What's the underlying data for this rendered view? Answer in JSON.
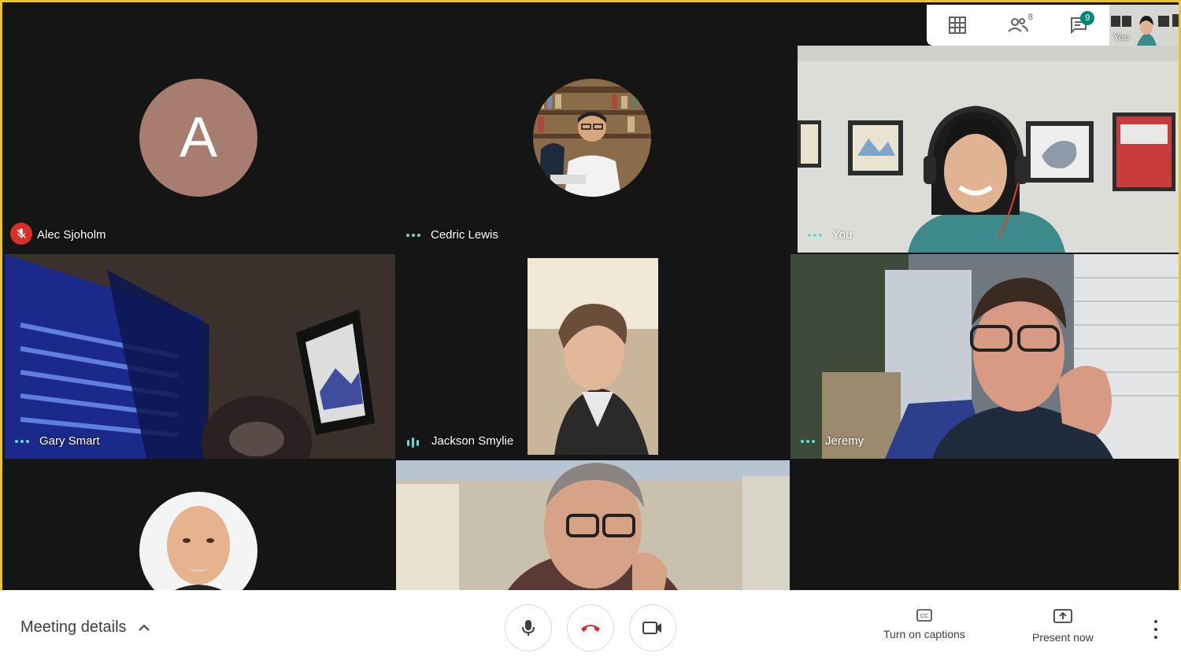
{
  "participants": {
    "alec": {
      "name": "Alec Sjoholm",
      "initial": "A",
      "muted": true
    },
    "cedric": {
      "name": "Cedric Lewis"
    },
    "you": {
      "name": "You"
    },
    "gary": {
      "name": "Gary Smart"
    },
    "jackson": {
      "name": "Jackson Smylie"
    },
    "jeremy": {
      "name": "Jeremy"
    }
  },
  "topbar": {
    "people_count": "8",
    "chat_badge": "9",
    "self_label": "You"
  },
  "bottombar": {
    "meeting_details": "Meeting details",
    "captions_label": "Turn on captions",
    "present_label": "Present now"
  },
  "colors": {
    "active_speaker": "#5fe0cf",
    "mute_red": "#d93025",
    "avatar_bg": "#a67d6e",
    "hangup_red": "#d93025",
    "chat_badge": "#00897b",
    "window_border": "#e8c23a"
  }
}
